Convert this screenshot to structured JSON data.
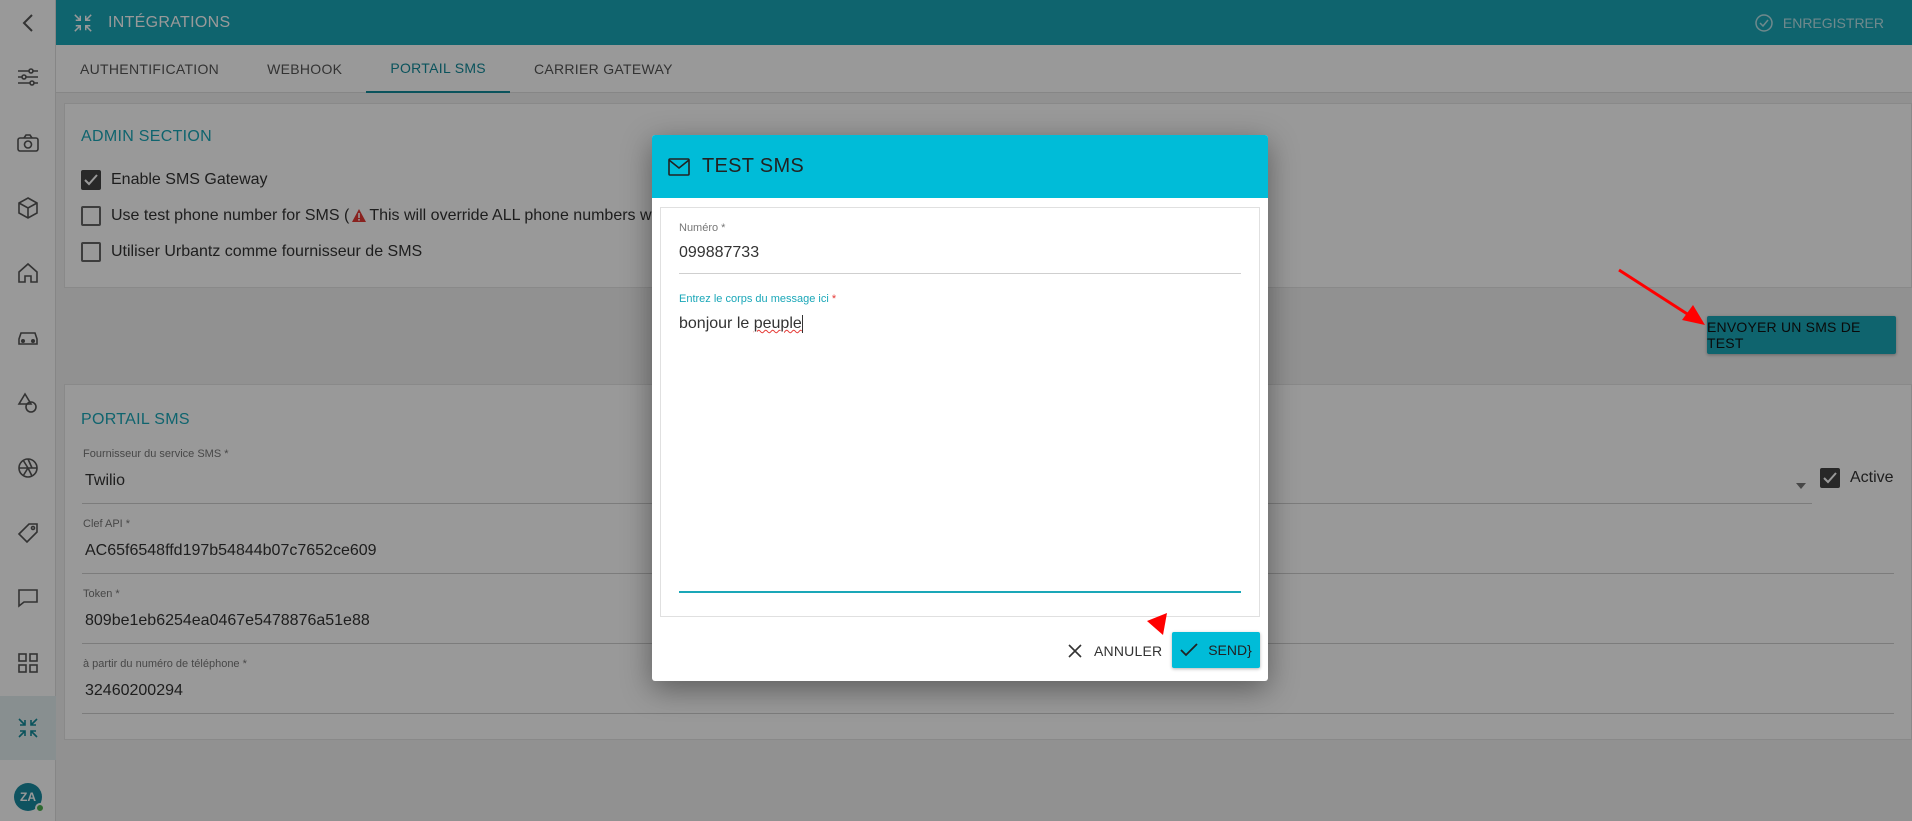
{
  "topbar": {
    "title": "INTÉGRATIONS",
    "save_label": "ENREGISTRER"
  },
  "tabs": [
    {
      "label": "AUTHENTIFICATION"
    },
    {
      "label": "WEBHOOK"
    },
    {
      "label": "PORTAIL SMS"
    },
    {
      "label": "CARRIER GATEWAY"
    }
  ],
  "admin": {
    "title": "ADMIN SECTION",
    "enable_gateway": "Enable SMS Gateway",
    "test_phone_pre": "Use test phone number for SMS (",
    "test_phone_post": " This will override ALL phone numbers wh",
    "use_urbantz": "Utiliser Urbantz comme fournisseur de SMS"
  },
  "send_test_label": "ENVOYER UN SMS DE TEST",
  "portal": {
    "title": "PORTAIL SMS",
    "provider_label": "Fournisseur du service SMS *",
    "provider_value": "Twilio",
    "active_label": "Active",
    "api_key_label": "Clef API *",
    "api_key_value": "AC65f6548ffd197b54844b07c7652ce609",
    "token_label": "Token *",
    "token_value": "809be1eb6254ea0467e5478876a51e88",
    "from_label": "à partir du numéro de téléphone *",
    "from_value": "32460200294"
  },
  "dialog": {
    "title": "TEST SMS",
    "number_label": "Numéro *",
    "number_value": "099887733",
    "message_label": "Entrez le corps du message ici",
    "message_required": " *",
    "message_value_a": "bonjour le ",
    "message_value_b": "peuple",
    "cancel_label": "ANNULER",
    "send_label": "SEND}"
  },
  "avatar_initials": "ZA",
  "colors": {
    "accent": "#1aa7b8",
    "dialog_header": "#00bcd8",
    "annotation": "#ff0000"
  }
}
